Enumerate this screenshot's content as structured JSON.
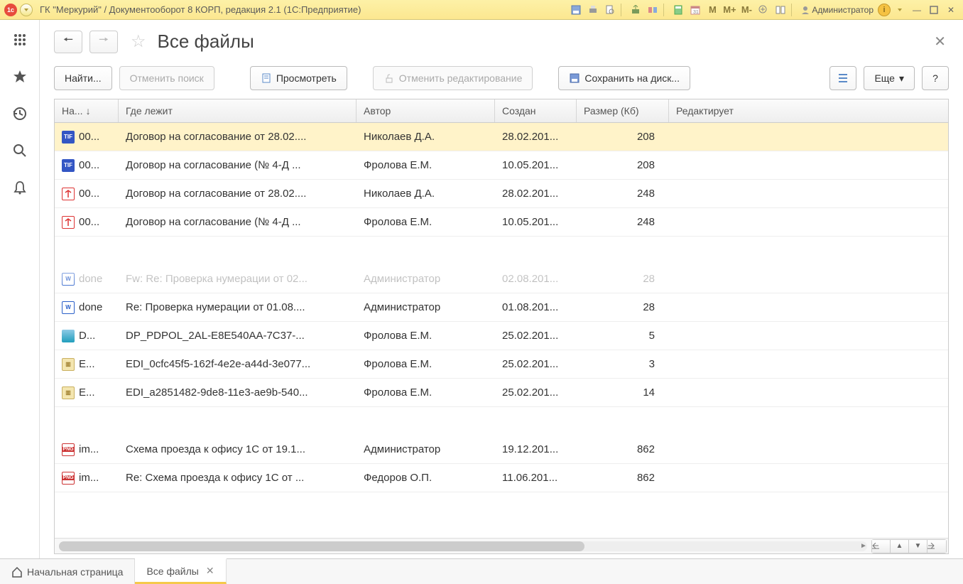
{
  "titlebar": {
    "title": "ГК \"Меркурий\" / Документооборот 8 КОРП, редакция 2.1  (1С:Предприятие)",
    "m": "M",
    "mp": "M+",
    "mm": "M-",
    "user": "Администратор"
  },
  "page": {
    "title": "Все файлы"
  },
  "toolbar": {
    "find": "Найти...",
    "cancel_search": "Отменить поиск",
    "view": "Просмотреть",
    "cancel_edit": "Отменить редактирование",
    "save_disk": "Сохранить на диск...",
    "more": "Еще",
    "help": "?"
  },
  "columns": {
    "name": "На...",
    "sort_arrow": "↓",
    "path": "Где лежит",
    "author": "Автор",
    "created": "Создан",
    "size": "Размер (Кб)",
    "editing": "Редактирует"
  },
  "rows": [
    {
      "icon": "tif",
      "name": "00...",
      "path": "Договор на согласование от 28.02....",
      "author": "Николаев Д.А.",
      "created": "28.02.201...",
      "size": "208",
      "edit": "",
      "selected": true
    },
    {
      "icon": "tif",
      "name": "00...",
      "path": "Договор на согласование (№ 4-Д ...",
      "author": "Фролова Е.М.",
      "created": "10.05.201...",
      "size": "208",
      "edit": ""
    },
    {
      "icon": "pdf",
      "name": "00...",
      "path": "Договор на согласование от 28.02....",
      "author": "Николаев Д.А.",
      "created": "28.02.201...",
      "size": "248",
      "edit": ""
    },
    {
      "icon": "pdf",
      "name": "00...",
      "path": "Договор на согласование (№ 4-Д ...",
      "author": "Фролова Е.М.",
      "created": "10.05.201...",
      "size": "248",
      "edit": ""
    }
  ],
  "rows2": [
    {
      "icon": "doc",
      "name": "done",
      "path": "Fw: Re: Проверка нумерации от 02...",
      "author": "Администратор",
      "created": "02.08.201...",
      "size": "28",
      "edit": "",
      "faded": true
    },
    {
      "icon": "doc",
      "name": "done",
      "path": "Re: Проверка нумерации от 01.08....",
      "author": "Администратор",
      "created": "01.08.201...",
      "size": "28",
      "edit": ""
    },
    {
      "icon": "bin",
      "name": "D...",
      "path": "DP_PDPOL_2AL-E8E540AA-7C37-...",
      "author": "Фролова Е.М.",
      "created": "25.02.201...",
      "size": "5",
      "edit": ""
    },
    {
      "icon": "zip",
      "name": "E...",
      "path": "EDI_0cfc45f5-162f-4e2e-a44d-3e077...",
      "author": "Фролова Е.М.",
      "created": "25.02.201...",
      "size": "3",
      "edit": ""
    },
    {
      "icon": "zip",
      "name": "E...",
      "path": "EDI_a2851482-9de8-11e3-ae9b-540...",
      "author": "Фролова Е.М.",
      "created": "25.02.201...",
      "size": "14",
      "edit": ""
    }
  ],
  "rows3": [
    {
      "icon": "png",
      "name": "im...",
      "path": "Схема проезда к офису 1С от 19.1...",
      "author": "Администратор",
      "created": "19.12.201...",
      "size": "862",
      "edit": ""
    },
    {
      "icon": "png",
      "name": "im...",
      "path": "Re: Схема проезда к офису 1С от ...",
      "author": "Федоров О.П.",
      "created": "11.06.201...",
      "size": "862",
      "edit": ""
    }
  ],
  "tabs": {
    "home": "Начальная страница",
    "files": "Все файлы"
  }
}
